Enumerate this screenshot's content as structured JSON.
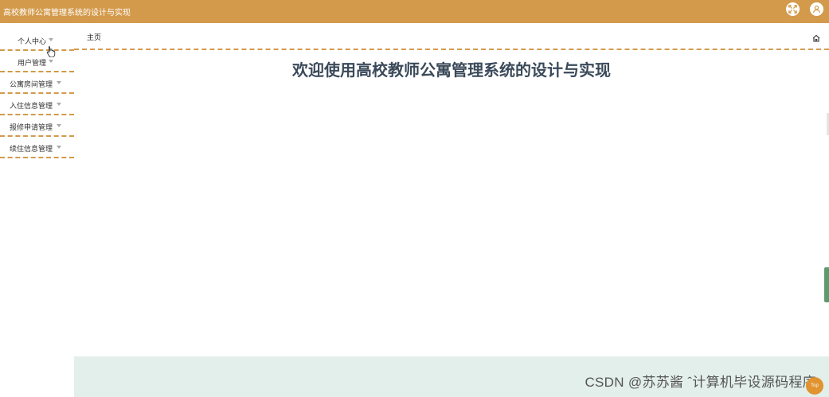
{
  "header": {
    "title": "高校教师公寓管理系统的设计与实现",
    "fullscreen_icon": "fullscreen-icon",
    "user_icon": "user-icon"
  },
  "sidebar": {
    "items": [
      {
        "label": "个人中心"
      },
      {
        "label": "用户管理"
      },
      {
        "label": "公寓房间管理"
      },
      {
        "label": "入住信息管理"
      },
      {
        "label": "报修申请管理"
      },
      {
        "label": "续住信息管理"
      }
    ]
  },
  "breadcrumb": {
    "home_label": "主页",
    "home_icon": "home-icon"
  },
  "main": {
    "welcome": "欢迎使用高校教师公寓管理系统的设计与实现"
  },
  "footer": {
    "watermark": "CSDN @苏苏酱  ˆ计算机毕设源码程序",
    "top_label": "Top"
  },
  "colors": {
    "accent": "#d39a4b",
    "footer_bg": "#e3efeb",
    "title_text": "#3b4a5a"
  }
}
